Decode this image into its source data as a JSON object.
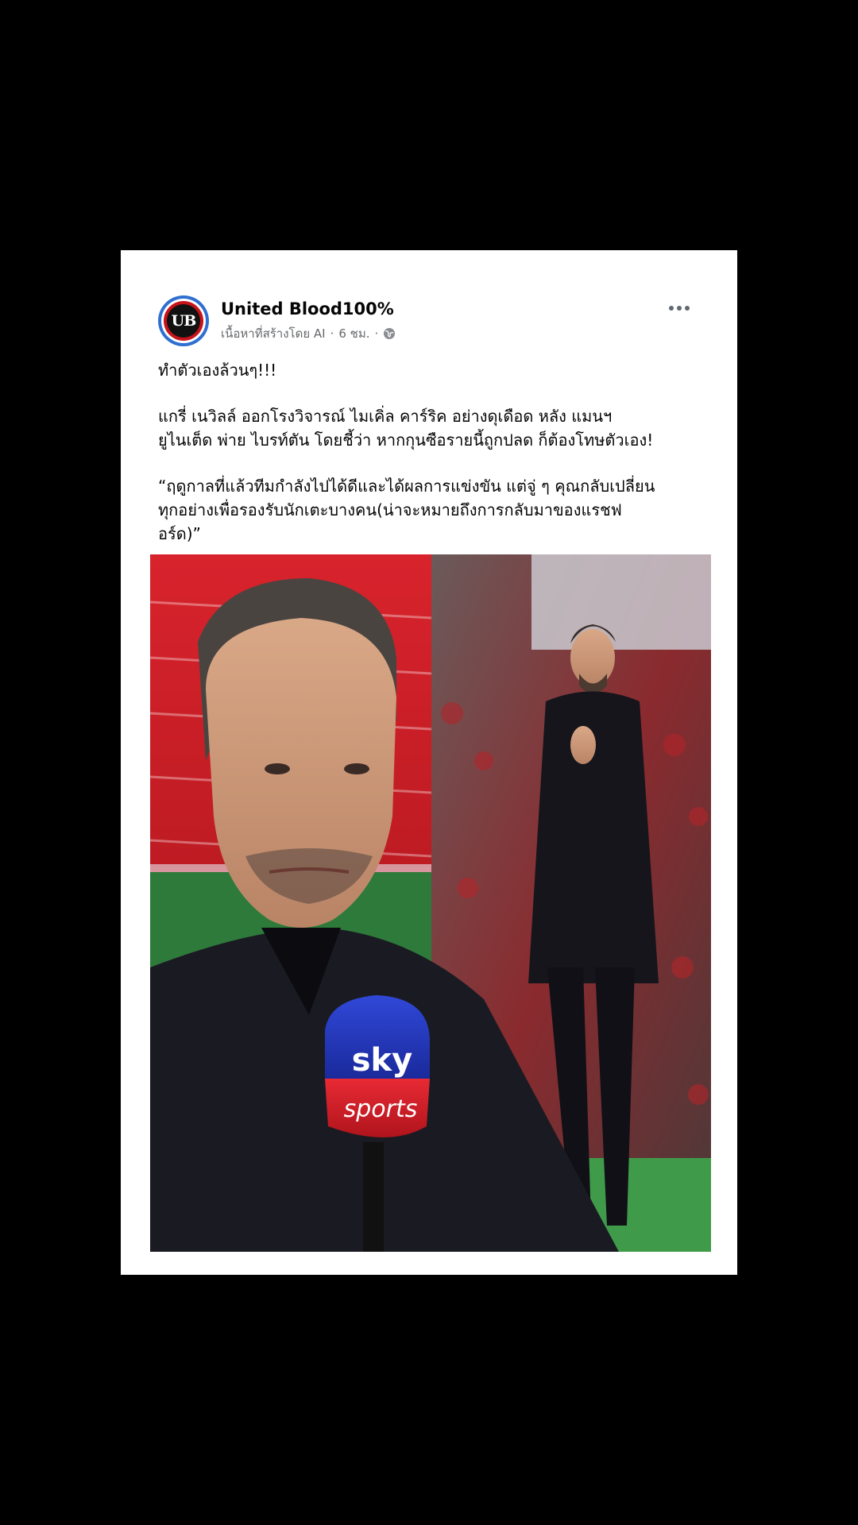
{
  "post": {
    "page_name": "United Blood100%",
    "avatar_text": "UB",
    "meta_label": "เนื้อหาที่สร้างโดย AI",
    "meta_separator": "·",
    "time": "6 ชม.",
    "paragraphs": [
      "ทำตัวเองล้วนๆ!!!",
      "แกรี่ เนวิลล์ ออกโรงวิจารณ์ ไมเคิ่ล คาร์ริค อย่างดุเดือด หลัง แมนฯ\nยูไนเต็ด พ่าย ไบรท์ตัน โดยชี้ว่า หากกุนซือรายนี้ถูกปลด ก็ต้องโทษตัวเอง!",
      "“ฤดูกาลที่แล้วทีมกำลังไปได้ดีและได้ผลการแข่งขัน แต่จู่ ๆ คุณกลับเปลี่ยน\nทุกอย่างเพื่อรองรับนักเตะบางคน(น่าจะหมายถึงการกลับมาของแรชฟ\nอร์ด)”"
    ]
  },
  "image": {
    "mic_brand_top": "sky",
    "mic_brand_bottom": "sports"
  },
  "colors": {
    "background": "#000000",
    "card": "#ffffff",
    "avatar_ring": "#2f6fd0",
    "avatar_red": "#c7141a",
    "meta_gray": "#65676b"
  }
}
